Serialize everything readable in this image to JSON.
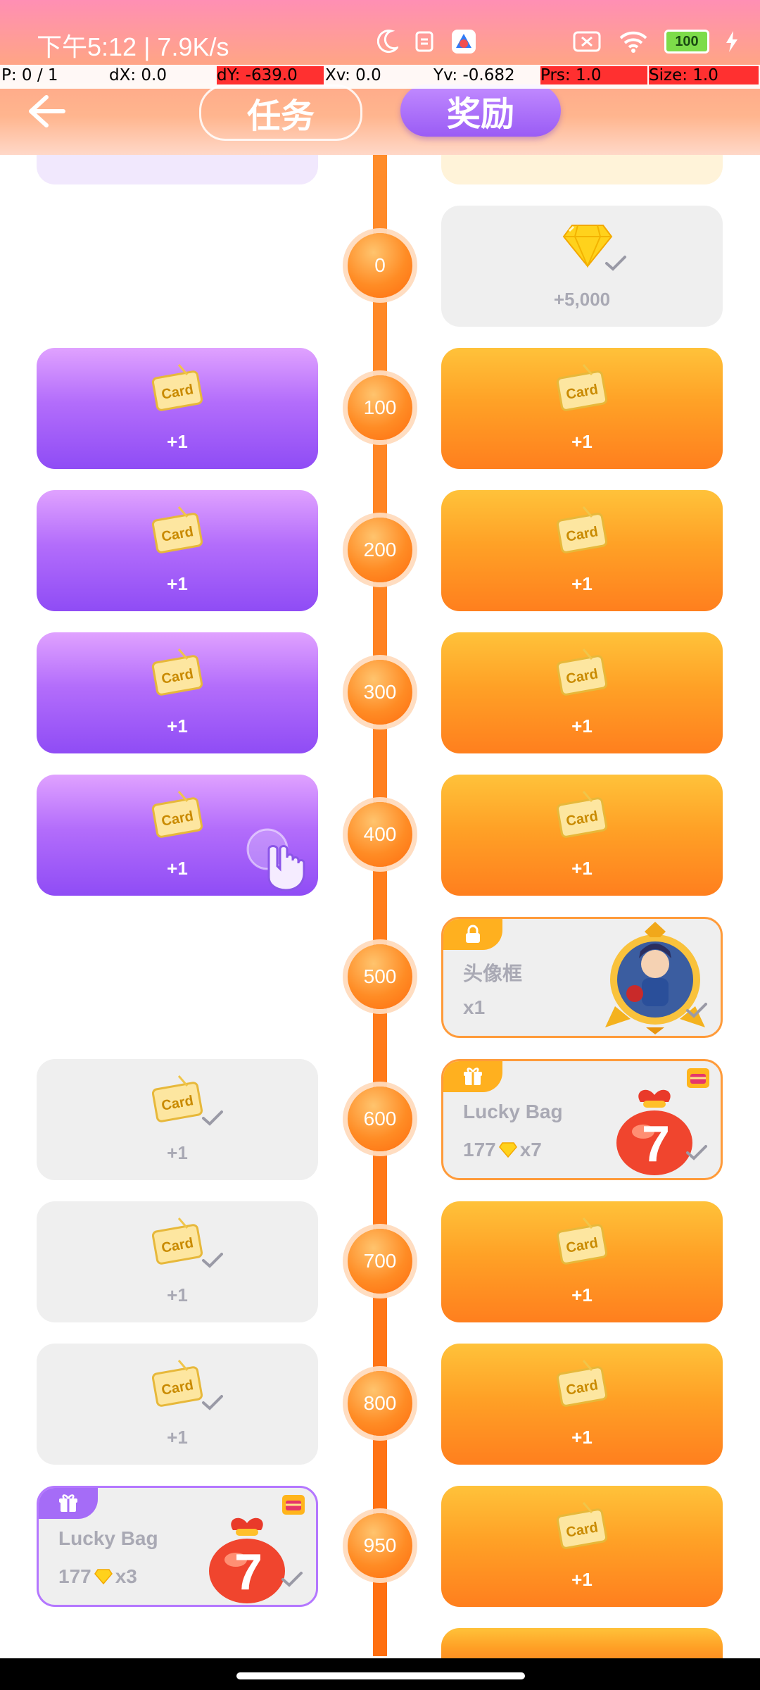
{
  "status_bar": {
    "time_text": "下午5:12 | 7.9K/s",
    "battery_level": "100"
  },
  "debug_overlay": {
    "p": "P: 0 / 1",
    "dx": "dX: 0.0",
    "dy": "dY: -639.0",
    "xv": "Xv: 0.0",
    "yv": "Yv: -0.682",
    "prs": "Prs: 1.0",
    "size": "Size: 1.0"
  },
  "header": {
    "tabs": [
      {
        "label": "任务",
        "active": false
      },
      {
        "label": "奖励",
        "active": true
      }
    ]
  },
  "timeline": {
    "milestones": [
      "0",
      "100",
      "200",
      "300",
      "400",
      "500",
      "600",
      "700",
      "800",
      "950"
    ]
  },
  "rewards": {
    "top_gem": {
      "label": "+5,000"
    },
    "card_label": "+1",
    "card_icon_text": "Card",
    "avatar_frame": {
      "title": "头像框",
      "count": "x1"
    },
    "lucky_bag_right": {
      "title": "Lucky Bag",
      "count_prefix": "177",
      "count_suffix": "x7",
      "number": "7"
    },
    "lucky_bag_left": {
      "title": "Lucky Bag",
      "count_prefix": "177",
      "count_suffix": "x3",
      "number": "7"
    }
  },
  "colors": {
    "purple": "#9a5cf5",
    "orange": "#ff8c1e",
    "grey": "#efefef"
  }
}
